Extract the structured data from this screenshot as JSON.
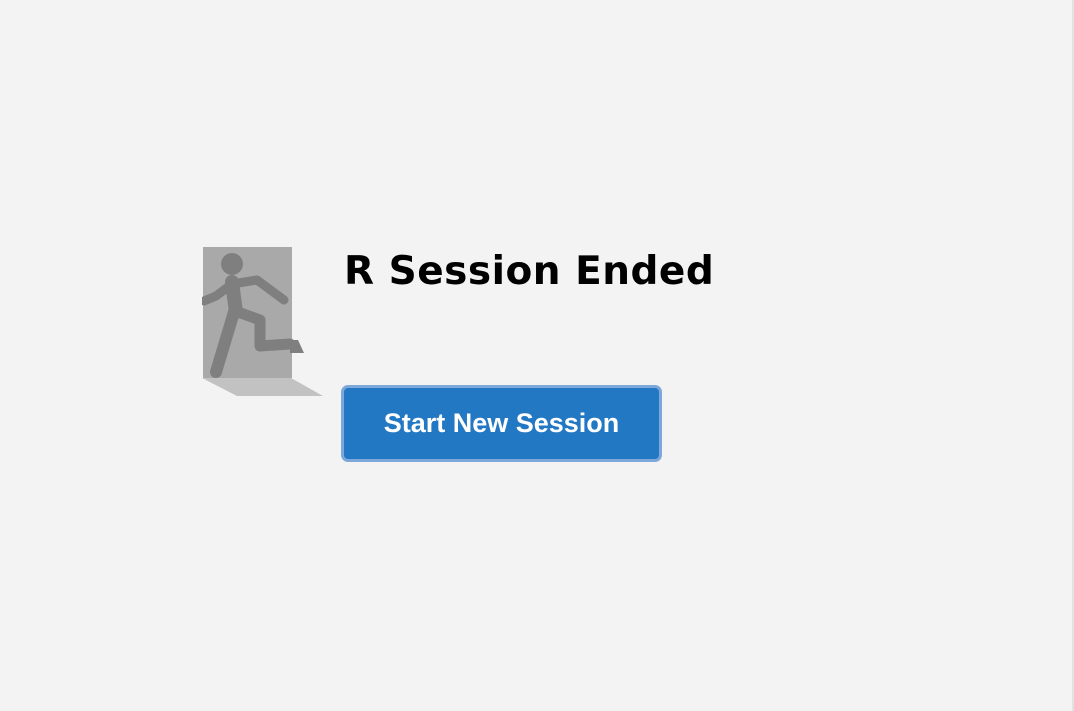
{
  "title": "R Session Ended",
  "button": {
    "label": "Start New Session"
  },
  "icon": {
    "name": "exit-door-icon"
  },
  "colors": {
    "background": "#f3f3f3",
    "button_fill": "#2378c4",
    "button_border": "#7fa8da",
    "icon_door": "#a9a9a9",
    "icon_figure": "#7f7f7f",
    "icon_shadow": "#c2c2c2"
  }
}
